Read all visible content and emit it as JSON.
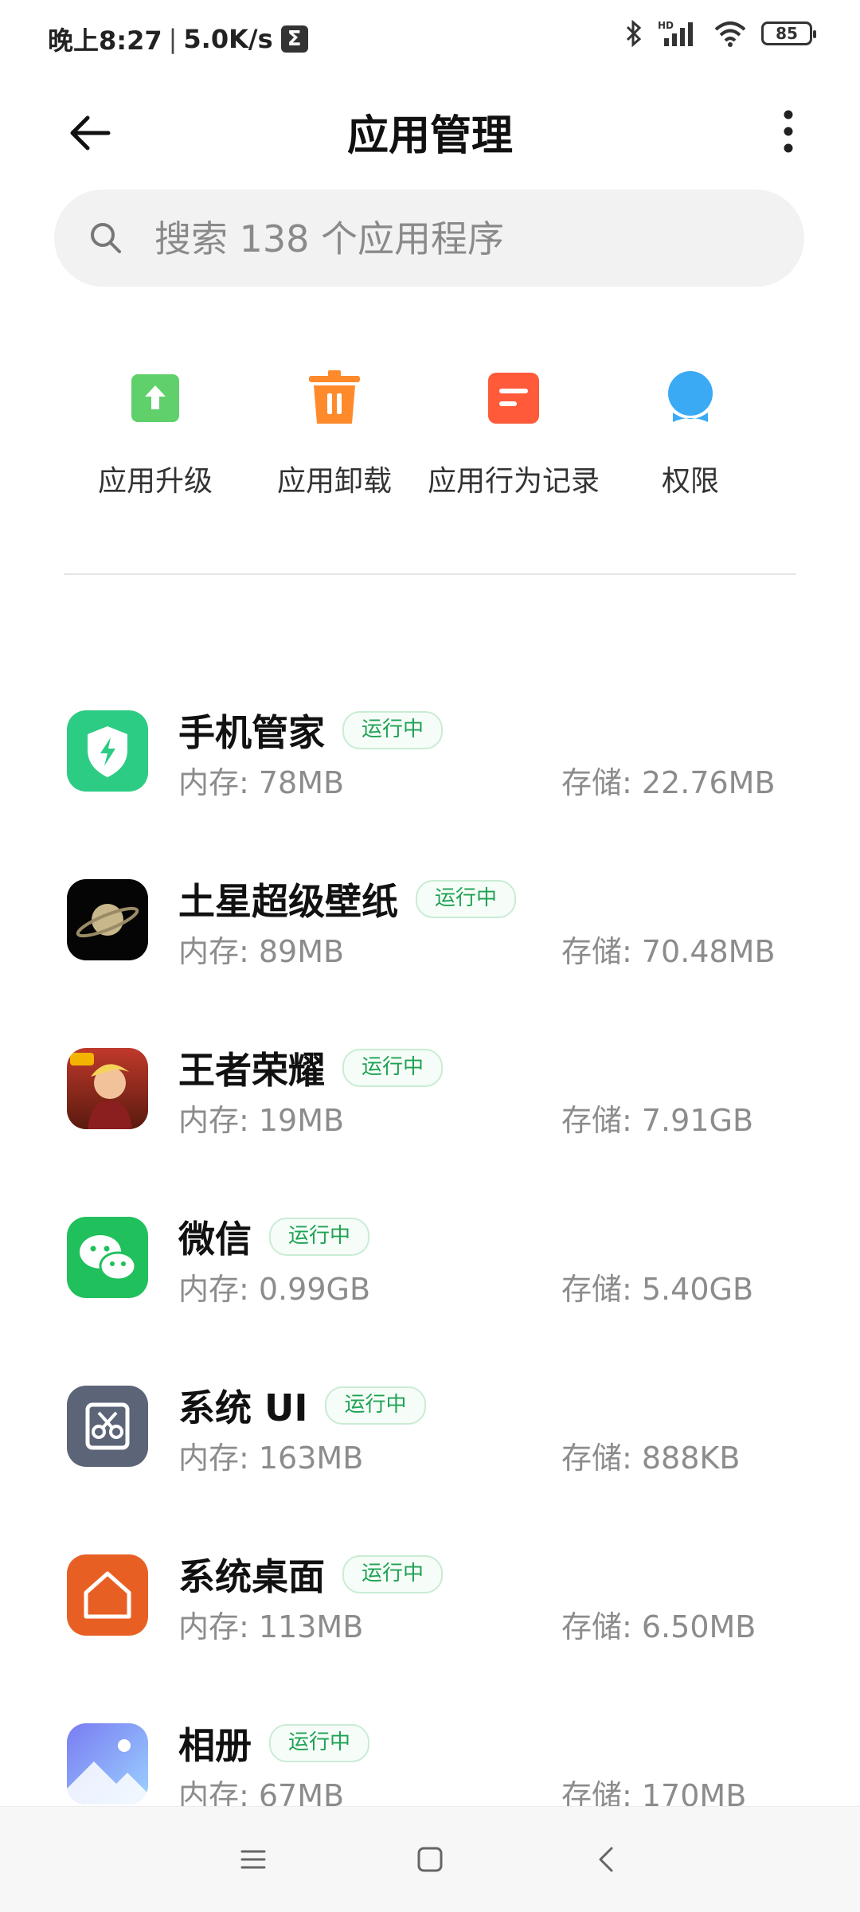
{
  "status_bar": {
    "time": "晚上8:27",
    "speed": "5.0K/s",
    "app_glyph": "Σ",
    "battery": "85",
    "icons": [
      "bluetooth-icon",
      "hd-signal-icon",
      "wifi-icon",
      "battery-icon"
    ]
  },
  "header": {
    "title": "应用管理",
    "back_icon": "back-arrow-icon",
    "more_icon": "more-vertical-icon"
  },
  "search": {
    "placeholder": "搜索 138 个应用程序",
    "value": ""
  },
  "actions": [
    {
      "label": "应用升级",
      "icon": "upgrade-icon",
      "color": "#5fd06a"
    },
    {
      "label": "应用卸载",
      "icon": "trash-icon",
      "color": "#ff8a2b"
    },
    {
      "label": "应用行为记录",
      "icon": "record-icon",
      "color": "#ff5a3a"
    },
    {
      "label": "权限",
      "icon": "permission-icon",
      "color": "#3aaaf5"
    }
  ],
  "apps": [
    {
      "name": "手机管家",
      "status": "运行中",
      "memory": "内存: 78MB",
      "storage": "存储: 22.76MB",
      "icon": "security-shield-icon"
    },
    {
      "name": "土星超级壁纸",
      "status": "运行中",
      "memory": "内存: 89MB",
      "storage": "存储: 70.48MB",
      "icon": "saturn-icon"
    },
    {
      "name": "王者荣耀",
      "status": "运行中",
      "memory": "内存: 19MB",
      "storage": "存储: 7.91GB",
      "icon": "game-icon"
    },
    {
      "name": "微信",
      "status": "运行中",
      "memory": "内存: 0.99GB",
      "storage": "存储: 5.40GB",
      "icon": "wechat-icon"
    },
    {
      "name": "系统 UI",
      "status": "运行中",
      "memory": "内存: 163MB",
      "storage": "存储: 888KB",
      "icon": "system-ui-icon"
    },
    {
      "name": "系统桌面",
      "status": "运行中",
      "memory": "内存: 113MB",
      "storage": "存储: 6.50MB",
      "icon": "home-icon"
    },
    {
      "name": "相册",
      "status": "运行中",
      "memory": "内存: 67MB",
      "storage": "存储: 170MB",
      "icon": "gallery-icon"
    }
  ],
  "navbar": {
    "icons": [
      "menu-icon",
      "home-square-icon",
      "back-chevron-icon"
    ]
  }
}
